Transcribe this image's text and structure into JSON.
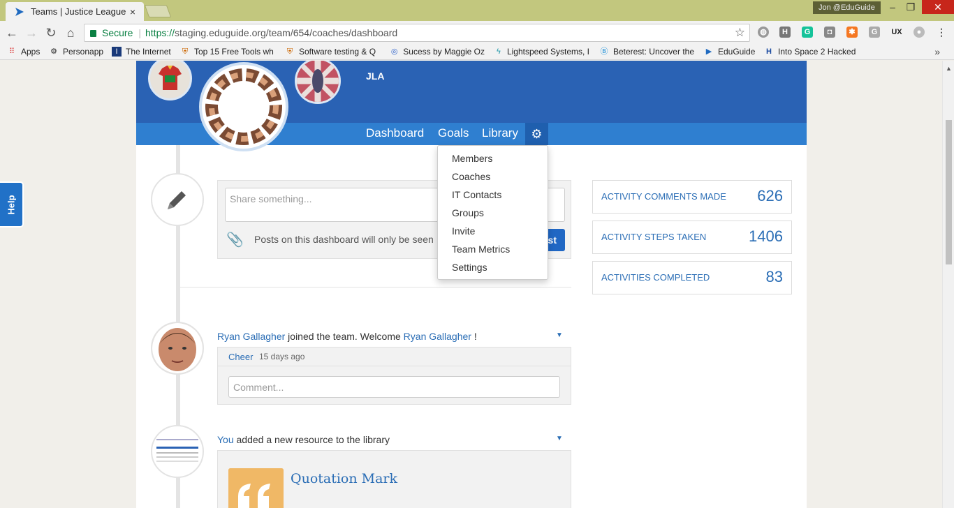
{
  "browser": {
    "tab_title": "Teams | Justice League o",
    "tab_close": "×",
    "profile_name": "Jon @EduGuide",
    "window_minimize": "–",
    "window_restore": "❐",
    "window_close": "✕",
    "secure_label": "Secure",
    "url_scheme": "https://",
    "url_rest": "staging.eduguide.org/team/654/coaches/dashboard",
    "bookmarks": [
      {
        "label": "Apps",
        "icon": "apps-grid-icon"
      },
      {
        "label": "Personapp",
        "icon": "personapp-icon"
      },
      {
        "label": "The Internet",
        "icon": "internet-icon"
      },
      {
        "label": "Top 15 Free Tools wh",
        "icon": "shield-icon"
      },
      {
        "label": "Software testing & Q",
        "icon": "shield-icon"
      },
      {
        "label": "Sucess by Maggie Oz",
        "icon": "swirl-icon"
      },
      {
        "label": "Lightspeed Systems, I",
        "icon": "lightspeed-icon"
      },
      {
        "label": "Beterest: Uncover the",
        "icon": "beterest-icon"
      },
      {
        "label": "EduGuide",
        "icon": "eduguide-icon"
      },
      {
        "label": "Into Space 2 Hacked",
        "icon": "hacked-icon"
      }
    ],
    "bookmarks_more": "»",
    "extensions": [
      "globe-icon",
      "h-icon",
      "g-icon",
      "camera-icon",
      "hubspot-icon",
      "g2-icon",
      "ux-icon",
      "circle-icon",
      "menu-icon"
    ]
  },
  "team": {
    "name": "JLA",
    "nav": [
      "Dashboard",
      "Goals",
      "Library"
    ],
    "gear_glyph": "⚙"
  },
  "dropdown": {
    "items": [
      "Members",
      "Coaches",
      "IT Contacts",
      "Groups",
      "Invite",
      "Team Metrics",
      "Settings"
    ]
  },
  "share": {
    "placeholder": "Share something...",
    "note": "Posts on this dashboard will only be seen",
    "post_label": "st"
  },
  "feed": [
    {
      "user": "Ryan Gallagher",
      "text": " joined the team. Welcome ",
      "user2": "Ryan Gallagher",
      "end": " !",
      "cheer": "Cheer",
      "time": "15 days ago",
      "comment_placeholder": "Comment..."
    },
    {
      "user": "You",
      "text": " added a new resource to the library",
      "resource_title": "Quotation Mark"
    }
  ],
  "stats": [
    {
      "label": "ACTIVITY COMMENTS MADE",
      "value": "626"
    },
    {
      "label": "ACTIVITY STEPS TAKEN",
      "value": "1406"
    },
    {
      "label": "ACTIVITIES COMPLETED",
      "value": "83"
    }
  ],
  "help_label": "Help",
  "colors": {
    "header": "#2a62b4",
    "nav": "#2f7fd0",
    "link": "#2a6db5",
    "titlebar": "#c2c77e"
  }
}
